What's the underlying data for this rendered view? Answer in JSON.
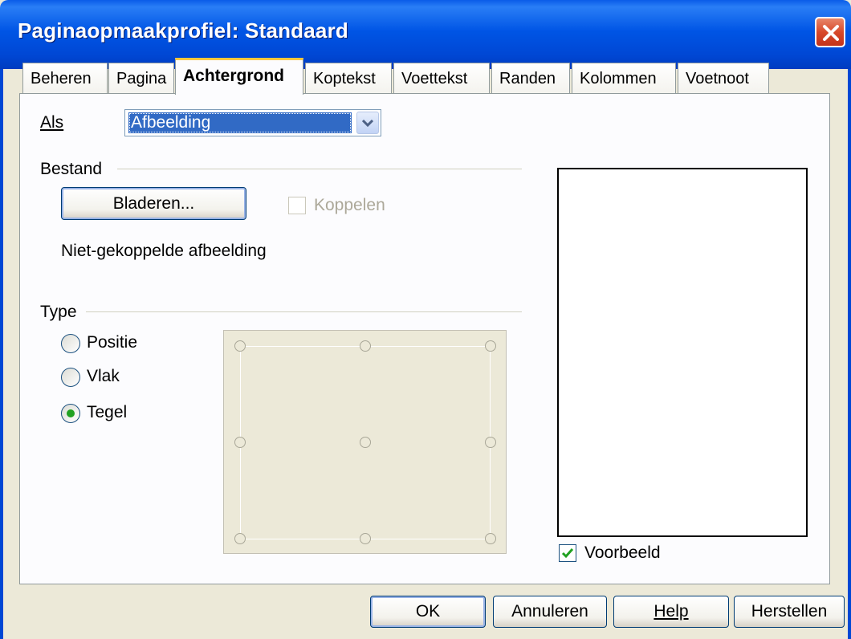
{
  "window": {
    "title": "Paginaopmaakprofiel: Standaard"
  },
  "tabs": [
    {
      "label": "Beheren"
    },
    {
      "label": "Pagina"
    },
    {
      "label": "Achtergrond"
    },
    {
      "label": "Koptekst"
    },
    {
      "label": "Voettekst"
    },
    {
      "label": "Randen"
    },
    {
      "label": "Kolommen"
    },
    {
      "label": "Voetnoot"
    }
  ],
  "background": {
    "as_label": "Als",
    "as_value": "Afbeelding",
    "file_section": "Bestand",
    "browse_button": "Bladeren...",
    "link_label": "Koppelen",
    "link_status": "Niet-gekoppelde afbeelding",
    "type_section": "Type",
    "radio_position": "Positie",
    "radio_area": "Vlak",
    "radio_tile": "Tegel",
    "preview_label": "Voorbeeld",
    "preview_checked": true,
    "selected_type": "Tegel"
  },
  "buttons": {
    "ok": "OK",
    "cancel": "Annuleren",
    "help": "Help",
    "reset": "Herstellen"
  },
  "colors": {
    "title_bar": "#0054e3",
    "selection": "#316ac5",
    "active_tab_accent": "#ffc83c",
    "radio_dot": "#21a121"
  }
}
